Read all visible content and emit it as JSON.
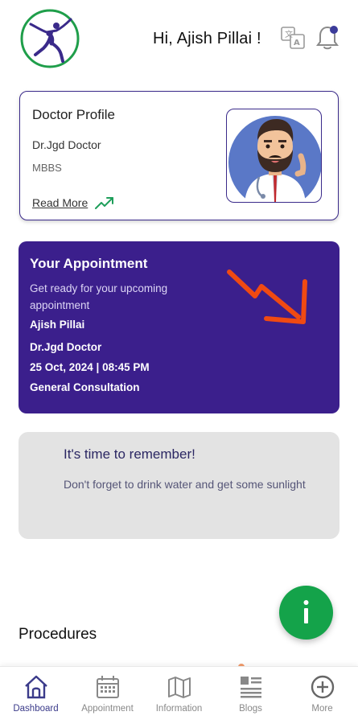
{
  "header": {
    "greeting": "Hi, Ajish Pillai !"
  },
  "profile_card": {
    "title": "Doctor Profile",
    "doctor_name": "Dr.Jgd Doctor",
    "degree": "MBBS",
    "read_more": "Read More"
  },
  "appointment": {
    "title": "Your Appointment",
    "subtitle": "Get ready for your upcoming appointment",
    "patient": "Ajish Pillai",
    "doctor": "Dr.Jgd Doctor",
    "datetime": "25 Oct, 2024 | 08:45 PM",
    "type": "General Consultation"
  },
  "reminder": {
    "title": "It's time to remember!",
    "text": "Don't forget to drink water and get some sunlight"
  },
  "fab": {
    "label": "i"
  },
  "section": {
    "procedures": "Procedures"
  },
  "nav": {
    "items": [
      {
        "label": "Dashboard",
        "icon": "home-icon"
      },
      {
        "label": "Appointment",
        "icon": "calendar-icon"
      },
      {
        "label": "Information",
        "icon": "map-icon"
      },
      {
        "label": "Blogs",
        "icon": "blog-list-icon"
      },
      {
        "label": "More",
        "icon": "plus-circle-icon"
      }
    ]
  },
  "colors": {
    "primary_purple": "#3b1f8c",
    "fab_green": "#14a34a",
    "arrow_orange": "#f04a12",
    "trend_green": "#1e9e5a",
    "reminder_bg": "#e3e3e3"
  }
}
